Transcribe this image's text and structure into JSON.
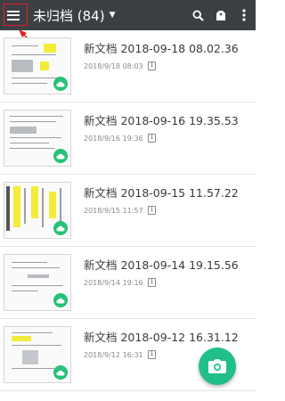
{
  "appbar": {
    "title": "未归档 (84)",
    "background": "#3c3f44",
    "icons": [
      "menu-icon",
      "dropdown-arrow-icon",
      "search-icon",
      "tag-icon",
      "more-vert-icon"
    ]
  },
  "annotation": {
    "color": "#e02020"
  },
  "documents": [
    {
      "title": "新文档 2018-09-18 08.02.36",
      "date": "2018/9/18 08:03",
      "pages": "1"
    },
    {
      "title": "新文档 2018-09-16 19.35.53",
      "date": "2018/9/16 19:36",
      "pages": "1"
    },
    {
      "title": "新文档 2018-09-15 11.57.22",
      "date": "2018/9/15 11:57",
      "pages": "1"
    },
    {
      "title": "新文档 2018-09-14 19.15.56",
      "date": "2018/9/14 19:16",
      "pages": "1"
    },
    {
      "title": "新文档 2018-09-12 16.31.12",
      "date": "2018/9/12 16:31",
      "pages": "1"
    }
  ],
  "fab": {
    "icon": "camera-icon",
    "color": "#1fbf87"
  },
  "status": {
    "cloud_icon": "cloud-synced-icon",
    "cloud_color": "#25c07a"
  }
}
